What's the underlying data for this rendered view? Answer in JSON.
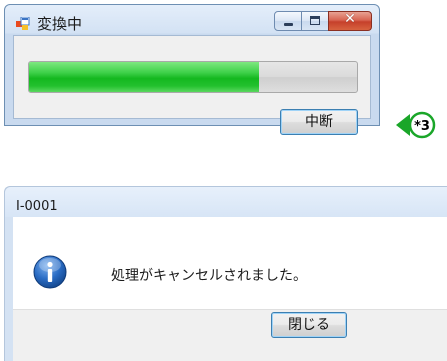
{
  "progress_window": {
    "title": "変換中",
    "progress": 0.7,
    "cancel_label": "中断"
  },
  "callout": {
    "label": "*3"
  },
  "message_dialog": {
    "title": "I-0001",
    "message": "処理がキャンセルされました。",
    "close_label": "閉じる"
  },
  "colors": {
    "progress_fill": "#14b81f",
    "callout_green": "#1aa629",
    "info_blue": "#1e5fb5"
  }
}
